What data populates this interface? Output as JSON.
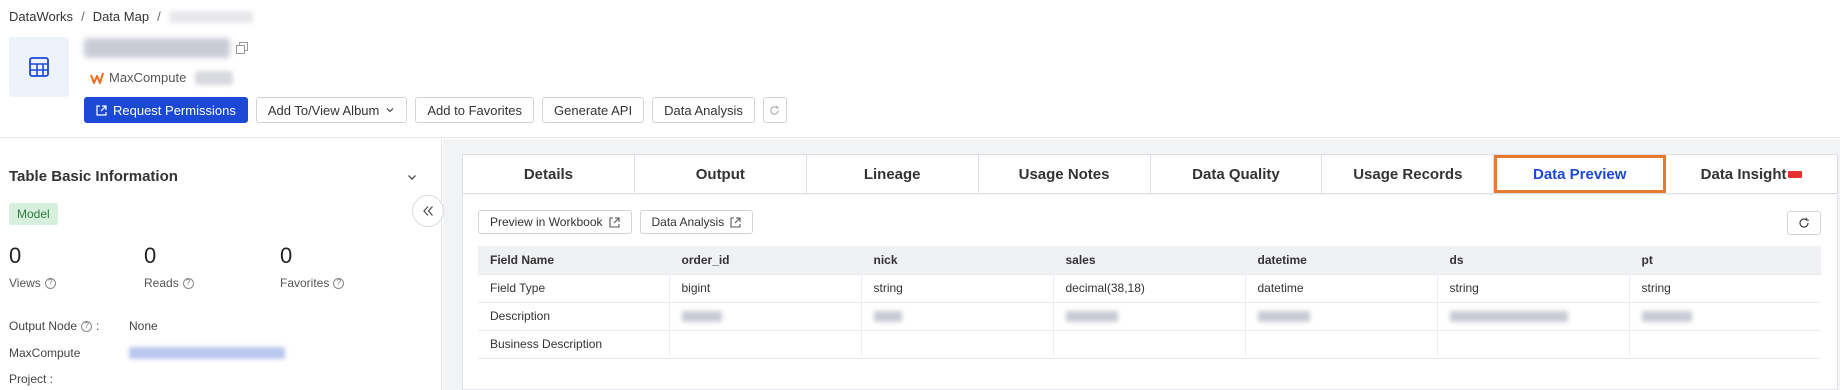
{
  "breadcrumb": {
    "item1": "DataWorks",
    "item2": "Data Map",
    "sep": "/"
  },
  "engine": {
    "label": "MaxCompute"
  },
  "actions": {
    "request_permissions": "Request Permissions",
    "add_to_album": "Add To/View Album",
    "add_to_favorites": "Add to Favorites",
    "generate_api": "Generate API",
    "data_analysis": "Data Analysis"
  },
  "left": {
    "title": "Table Basic Information",
    "badge": "Model",
    "stats": [
      {
        "num": "0",
        "label": "Views"
      },
      {
        "num": "0",
        "label": "Reads"
      },
      {
        "num": "0",
        "label": "Favorites"
      }
    ],
    "info": {
      "output_node_label": "Output Node",
      "output_node_colon": ":",
      "output_node_value": "None",
      "maxcompute_label": "MaxCompute",
      "project_label": "Project :"
    }
  },
  "tabs": [
    {
      "label": "Details"
    },
    {
      "label": "Output"
    },
    {
      "label": "Lineage"
    },
    {
      "label": "Usage Notes"
    },
    {
      "label": "Data Quality"
    },
    {
      "label": "Usage Records"
    },
    {
      "label": "Data Preview",
      "active": true
    },
    {
      "label": "Data Insight"
    }
  ],
  "preview": {
    "preview_in_workbook": "Preview in Workbook",
    "data_analysis": "Data Analysis",
    "headers": [
      "Field Name",
      "order_id",
      "nick",
      "sales",
      "datetime",
      "ds",
      "pt"
    ],
    "rows": [
      [
        "Field Type",
        "bigint",
        "string",
        "decimal(38,18)",
        "datetime",
        "string",
        "string"
      ],
      [
        "Description",
        "",
        "",
        "",
        "",
        "",
        ""
      ],
      [
        "Business Description",
        "",
        "",
        "",
        "",
        "",
        ""
      ]
    ]
  },
  "colors": {
    "accent": "#1b49d6",
    "active_outline": "#e87a2e",
    "badge_bg": "#d7f0dd",
    "badge_fg": "#2f7a3f"
  },
  "icons": {
    "table": "table-icon",
    "copy": "copy-icon",
    "maxcompute": "maxcompute-logo-icon",
    "external": "external-link-icon",
    "chevron": "chevron-down-icon",
    "refresh": "refresh-icon",
    "collapse": "double-chevron-left-icon",
    "help": "question-circle-icon"
  }
}
